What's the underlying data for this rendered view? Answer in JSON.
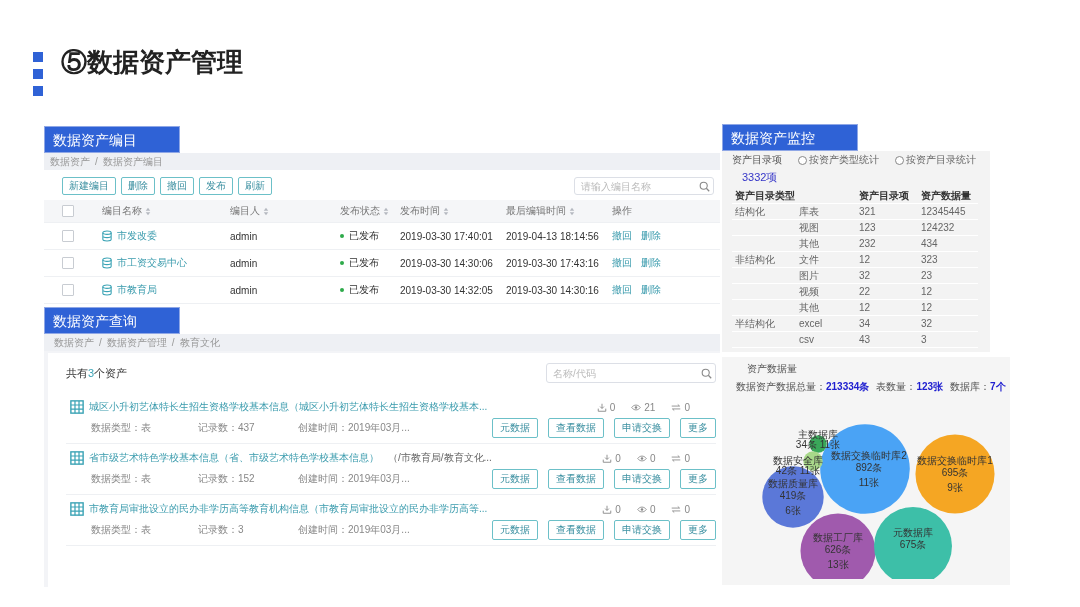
{
  "slide_title": "⑤数据资产管理",
  "breadcrumb_separator": "/",
  "catalog": {
    "label": "数据资产编目",
    "breadcrumb": [
      "数据资产",
      "数据资产编目"
    ],
    "toolbar_buttons": [
      "新建编目",
      "删除",
      "撤回",
      "发布",
      "刷新"
    ],
    "search": {
      "placeholder": "请输入编目名称"
    },
    "all_checked": false,
    "columns": [
      {
        "label": "编目名称",
        "kind": "sortable"
      },
      {
        "label": "编目人",
        "kind": "sortable"
      },
      {
        "label": "发布状态",
        "kind": "sortable"
      },
      {
        "label": "发布时间",
        "kind": "sortable"
      },
      {
        "label": "最后编辑时间",
        "kind": "sortable"
      },
      {
        "label": "操作",
        "kind": "plain"
      }
    ],
    "rows": [
      {
        "checked": false,
        "name": "市发改委",
        "owner": "admin",
        "status": "已发布",
        "published": true,
        "publish_time": "2019-03-30 17:40:01",
        "last_edit": "2019-04-13 18:14:56",
        "actions": [
          "撤回",
          "删除"
        ]
      },
      {
        "checked": false,
        "name": "市工资交易中心",
        "owner": "admin",
        "status": "已发布",
        "published": true,
        "publish_time": "2019-03-30 14:30:06",
        "last_edit": "2019-03-30 17:43:16",
        "actions": [
          "撤回",
          "删除"
        ]
      },
      {
        "checked": false,
        "name": "市教育局",
        "owner": "admin",
        "status": "已发布",
        "published": true,
        "publish_time": "2019-03-30 14:32:05",
        "last_edit": "2019-03-30 14:30:16",
        "actions": [
          "撤回",
          "删除"
        ]
      }
    ]
  },
  "query": {
    "label": "数据资产查询",
    "breadcrumb": [
      "数据资产",
      "数据资产管理",
      "教育文化"
    ],
    "summary": {
      "before": "共有",
      "count": "3",
      "after": "个资产"
    },
    "search": {
      "placeholder": "名称/代码"
    },
    "items": [
      {
        "title": "城区小升初艺体特长生招生资格学校基本信息（城区小升初艺体特长生招生资格学校基本...",
        "data_type": "数据类型：表",
        "records": "记录数：437",
        "created": "创建时间：2019年03月...",
        "downloads": "0",
        "views": "21",
        "exchanges": "0",
        "buttons": [
          "元数据",
          "查看数据",
          "申请交换",
          "更多"
        ]
      },
      {
        "title": "省市级艺术特色学校基本信息（省、市级艺术特色学校基本信息）",
        "path": "（/市教育局/教育文化...",
        "data_type": "数据类型：表",
        "records": "记录数：152",
        "created": "创建时间：2019年03月...",
        "downloads": "0",
        "views": "0",
        "exchanges": "0",
        "buttons": [
          "元数据",
          "查看数据",
          "申请交换",
          "更多"
        ]
      },
      {
        "title": "市教育局审批设立的民办非学历高等教育机构信息（市教育局审批设立的民办非学历高等...",
        "data_type": "数据类型：表",
        "records": "记录数：3",
        "created": "创建时间：2019年03月...",
        "downloads": "0",
        "views": "0",
        "exchanges": "0",
        "buttons": [
          "元数据",
          "查看数据",
          "申请交换",
          "更多"
        ]
      }
    ]
  },
  "monitor": {
    "label": "数据资产监控",
    "heading": "资产目录项",
    "options": [
      {
        "label": "按资产类型统计",
        "selected": false
      },
      {
        "label": "按资产目录统计",
        "selected": false
      }
    ],
    "total": "3332项",
    "columns": [
      "资产目录类型",
      "资产目录项",
      "资产数据量"
    ],
    "groups": [
      {
        "type": "结构化",
        "rows": [
          {
            "subtype": "库表",
            "items": "321",
            "volume": "12345445"
          },
          {
            "subtype": "视图",
            "items": "123",
            "volume": "124232"
          },
          {
            "subtype": "其他",
            "items": "232",
            "volume": "434"
          }
        ]
      },
      {
        "type": "非结构化",
        "rows": [
          {
            "subtype": "文件",
            "items": "12",
            "volume": "323"
          },
          {
            "subtype": "图片",
            "items": "32",
            "volume": "23"
          },
          {
            "subtype": "视频",
            "items": "22",
            "volume": "12"
          },
          {
            "subtype": "其他",
            "items": "12",
            "volume": "12"
          }
        ]
      },
      {
        "type": "半结构化",
        "rows": [
          {
            "subtype": "excel",
            "items": "34",
            "volume": "32"
          },
          {
            "subtype": "csv",
            "items": "43",
            "volume": "3"
          }
        ]
      }
    ]
  },
  "volume": {
    "title": "资产数据量",
    "stats": [
      {
        "label": "数据资产数据总量：",
        "value": "213334条"
      },
      {
        "label": "表数量：",
        "value": "123张"
      },
      {
        "label": "数据库：",
        "value": "7个"
      }
    ],
    "bubbles": [
      {
        "name": "数据交换临时库2",
        "count": "892条",
        "tables": "11张",
        "color": "#4aa3f5"
      },
      {
        "name": "数据交换临时库1",
        "count": "695条",
        "tables": "9张",
        "color": "#f5a623"
      },
      {
        "name": "数据质量库",
        "count": "419条",
        "tables": "6张",
        "color": "#5b78d8"
      },
      {
        "name": "数据工厂库",
        "count": "626条",
        "tables": "13张",
        "color": "#a05aad"
      },
      {
        "name": "元数据库",
        "count": "675条",
        "color": "#3dbfa8"
      },
      {
        "name": "主数据库",
        "count": "34条",
        "tables": "11张",
        "color": "#3aa85a"
      },
      {
        "name": "数据安全库",
        "count": "42条",
        "tables": "11张",
        "color": "#a8d88a"
      }
    ]
  }
}
